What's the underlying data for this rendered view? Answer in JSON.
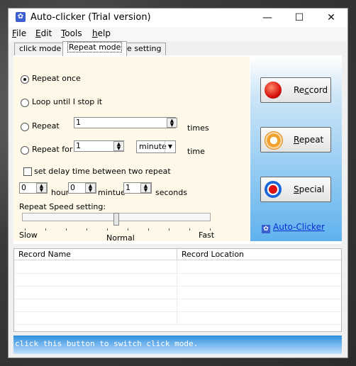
{
  "window": {
    "title": "Auto-clicker (Trial version)",
    "controls": {
      "minimize": "—",
      "maximize": "☐",
      "close": "✕"
    }
  },
  "menu": [
    {
      "label": "File",
      "accel": "F",
      "rest": "ile"
    },
    {
      "label": "Edit",
      "accel": "E",
      "rest": "dit"
    },
    {
      "label": "Tools",
      "accel": "T",
      "rest": "ools"
    },
    {
      "label": "help",
      "accel": "h",
      "rest": "elp"
    }
  ],
  "tabs": [
    {
      "label": "click mode",
      "active": false
    },
    {
      "label": "Repeat mode",
      "active": true
    },
    {
      "label": "ie setting",
      "active": false
    }
  ],
  "repeat": {
    "options": {
      "once": "Repeat once",
      "loop": "Loop until I stop it",
      "repeat": "Repeat",
      "repeat_for": "Repeat for"
    },
    "selected": "once",
    "repeat_count": "1",
    "times_label": "times",
    "repeat_for_value": "1",
    "repeat_for_unit": "minute",
    "time_label": "time",
    "delay_checkbox_label": "set delay time between two repeat",
    "delay_checked": false,
    "delay_hour": "0",
    "hour_label": "hour",
    "delay_minute": "0",
    "minute_label": "mintue",
    "delay_seconds": "1",
    "seconds_label": "seconds",
    "speed_label": "Repeat Speed setting:",
    "speed_slow": "Slow",
    "speed_normal": "Normal",
    "speed_fast": "Fast",
    "speed_level": 0.5
  },
  "actions": {
    "record": {
      "accel": "R",
      "text_before": "Re",
      "text_after": "cord",
      "underline": "c"
    },
    "repeat": {
      "text_before": "",
      "underline": "R",
      "text_after": "epeat"
    },
    "special": {
      "text_before": "",
      "underline": "S",
      "text_after": "pecial"
    },
    "link": "Auto-Clicker"
  },
  "table": {
    "columns": [
      "Record Name",
      "Record Location"
    ],
    "rows": [
      [
        "",
        ""
      ],
      [
        "",
        ""
      ],
      [
        "",
        ""
      ],
      [
        "",
        ""
      ],
      [
        "",
        ""
      ]
    ]
  },
  "status_text": "click this button to switch click mode.",
  "colors": {
    "accent_blue": "#2e8fe0",
    "panel_cream": "#fdf8e8",
    "link_blue": "#0a2bd0"
  }
}
